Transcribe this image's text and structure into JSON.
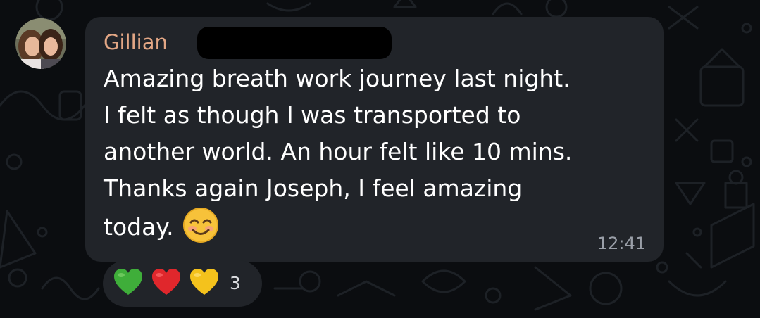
{
  "message": {
    "sender": "Gillian",
    "lines": [
      "Amazing breath work journey last night.",
      "I felt as though I was transported to",
      "another world. An hour felt like 10 mins.",
      "Thanks again Joseph, I feel amazing",
      "today."
    ],
    "emoji": "smiling-face-with-smiling-eyes",
    "timestamp": "12:41"
  },
  "reactions": {
    "items": [
      "green-heart",
      "red-heart",
      "yellow-heart"
    ],
    "count": "3"
  },
  "colors": {
    "background": "#0b0d10",
    "bubble": "#212429",
    "sender_name": "#e3a785",
    "text": "#ffffff",
    "timestamp": "#9a9fa8"
  }
}
